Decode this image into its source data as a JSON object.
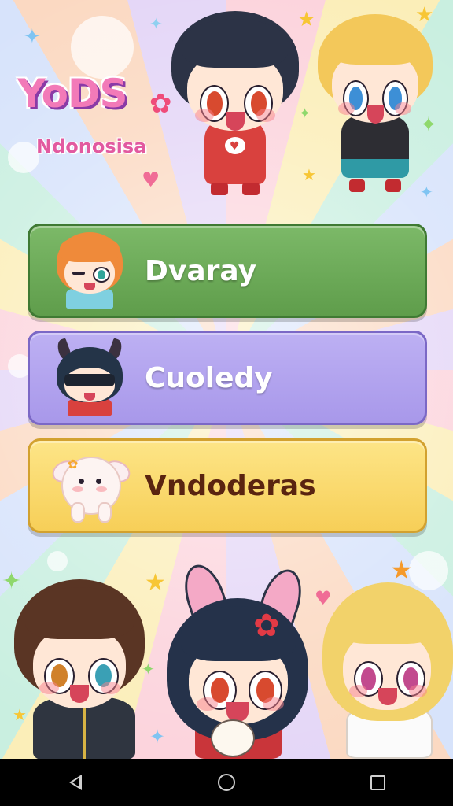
{
  "logo": {
    "title": "YoDS",
    "subtitle": "Ndonosisa"
  },
  "menu": [
    {
      "label": "Dvaray",
      "color": "#6aa958"
    },
    {
      "label": "Cuoledy",
      "color": "#b3a5ef"
    },
    {
      "label": "Vndoderas",
      "color": "#f9da6d"
    }
  ],
  "icons": {
    "logo_flower": "flower-icon",
    "heart": "heart-icon",
    "sparkles": "star-sparkle-icon",
    "nav": [
      "back-icon",
      "home-icon",
      "recent-apps-icon"
    ]
  },
  "colors": {
    "nav_bar": "#000000",
    "logo_pink": "#f27ab8",
    "button_green": "#6aa958",
    "button_purple": "#b3a5ef",
    "button_yellow": "#f9da6d"
  }
}
